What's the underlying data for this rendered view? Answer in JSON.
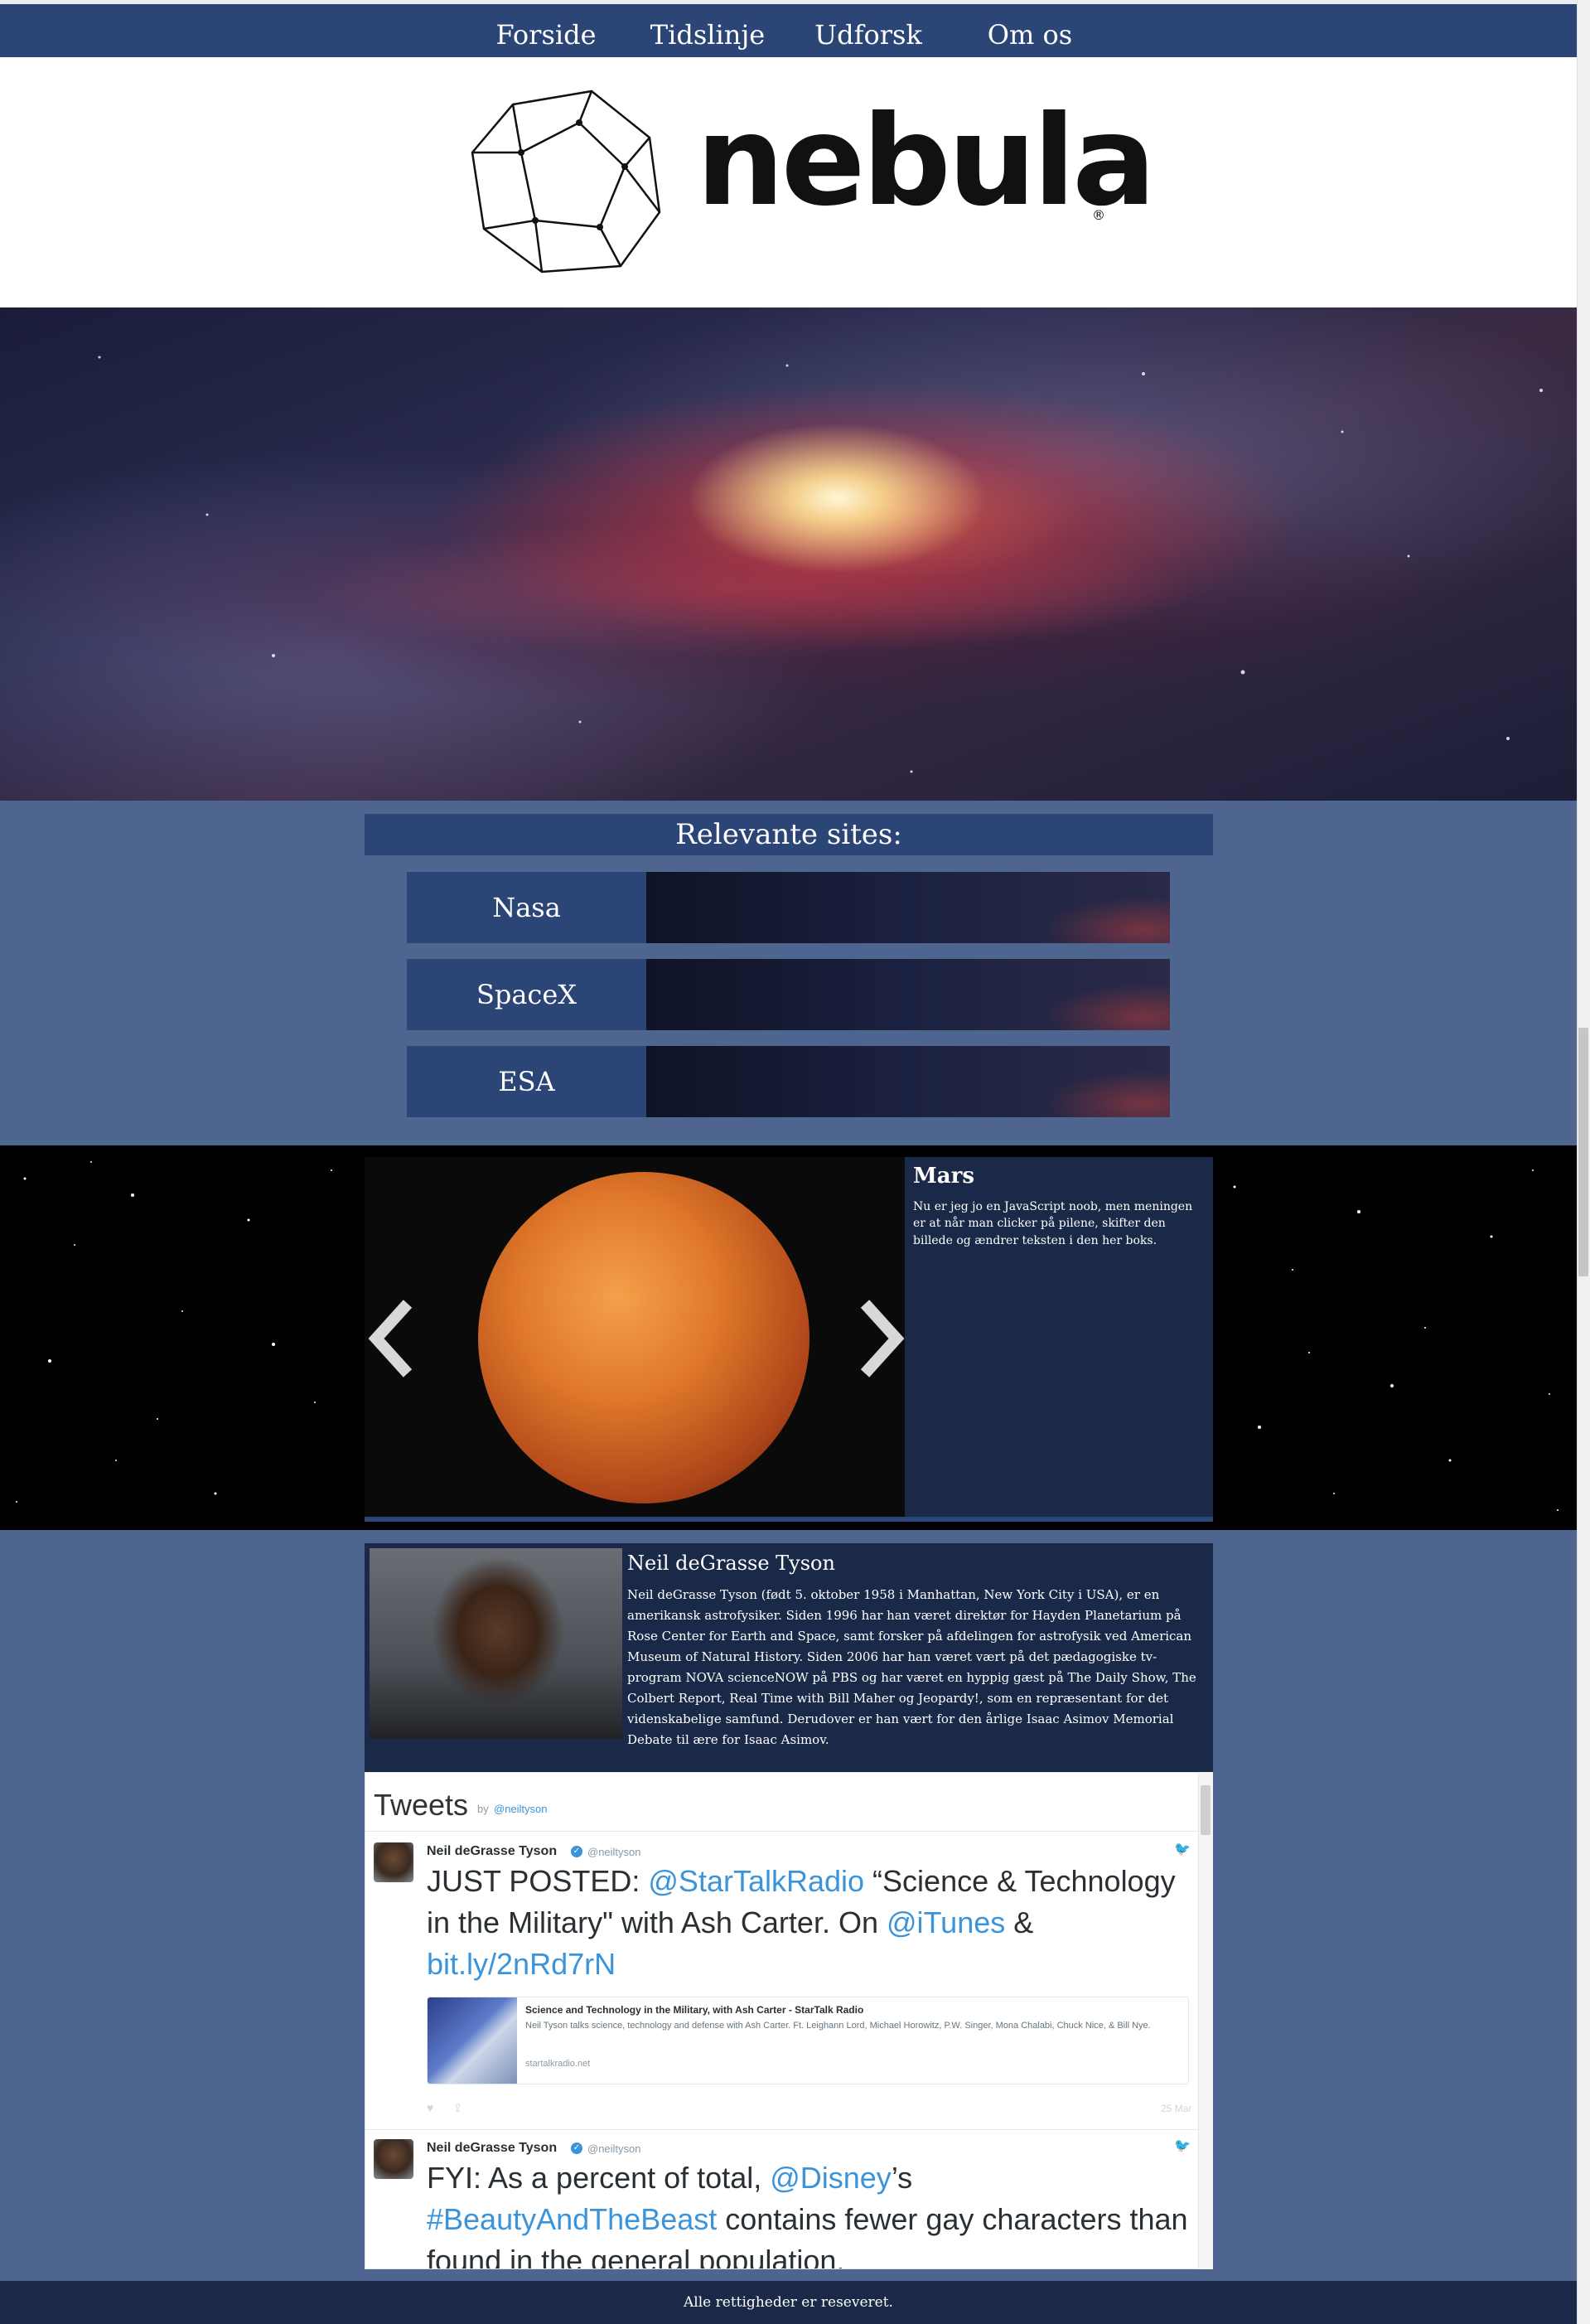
{
  "nav": {
    "items": [
      {
        "label": "Forside"
      },
      {
        "label": "Tidslinje"
      },
      {
        "label": "Udforsk"
      },
      {
        "label": "Om os"
      }
    ]
  },
  "header": {
    "logo_text": "nebula",
    "logo_registered": "®"
  },
  "sites": {
    "title": "Relevante sites:",
    "items": [
      {
        "label": "Nasa"
      },
      {
        "label": "SpaceX"
      },
      {
        "label": "ESA"
      }
    ]
  },
  "slider": {
    "title": "Mars",
    "text": "Nu er jeg jo en JavaScript noob, men meningen er at når man clicker på pilene, skifter den billede og ændrer teksten i den her boks."
  },
  "bio": {
    "name": "Neil deGrasse Tyson",
    "text": "Neil deGrasse Tyson (født 5. oktober 1958 i Manhattan, New York City i USA), er en amerikansk astrofysiker. Siden 1996 har han været direktør for Hayden Planetarium på Rose Center for Earth and Space, samt forsker på afdelingen for astrofysik ved American Museum of Natural History. Siden 2006 har han været vært på det pædagogiske tv-program NOVA scienceNOW på PBS og har været en hyppig gæst på The Daily Show, The Colbert Report, Real Time with Bill Maher og Jeopardy!, som en repræsentant for det videnskabelige samfund. Derudover er han vært for den årlige Isaac Asimov Memorial Debate til ære for Isaac Asimov."
  },
  "tweets": {
    "header": "Tweets",
    "by": "by",
    "handle": "@neiltyson",
    "items": [
      {
        "name": "Neil deGrasse Tyson",
        "handle": "@neiltyson",
        "t1": "JUST POSTED: ",
        "l1": "@StarTalkRadio",
        "t2": " “Science & Technology in the Military\" with Ash Carter. On ",
        "l2": "@iTunes",
        "t3": " & ",
        "l3": "bit.ly/2nRd7rN",
        "card_title": "Science and Technology in the Military, with Ash Carter - StarTalk Radio",
        "card_desc": "Neil Tyson talks science, technology and defense with Ash Carter. Ft. Leighann Lord, Michael Horowitz, P.W. Singer, Mona Chalabi, Chuck Nice, & Bill Nye.",
        "card_domain": "startalkradio.net",
        "time": "25 Mar"
      },
      {
        "name": "Neil deGrasse Tyson",
        "handle": "@neiltyson",
        "t1": "FYI: As a percent of total, ",
        "l1": "@Disney",
        "t2": "’s ",
        "l2": "#BeautyAndTheBeast",
        "t3": " contains fewer gay characters than found in the general population."
      }
    ]
  },
  "footer": {
    "text": "Alle rettigheder er reseveret."
  },
  "colors": {
    "nav_bg": "#2b4576",
    "page_bg": "#4e6590",
    "dark_panel": "#1a2948",
    "link": "#3b94d9"
  }
}
